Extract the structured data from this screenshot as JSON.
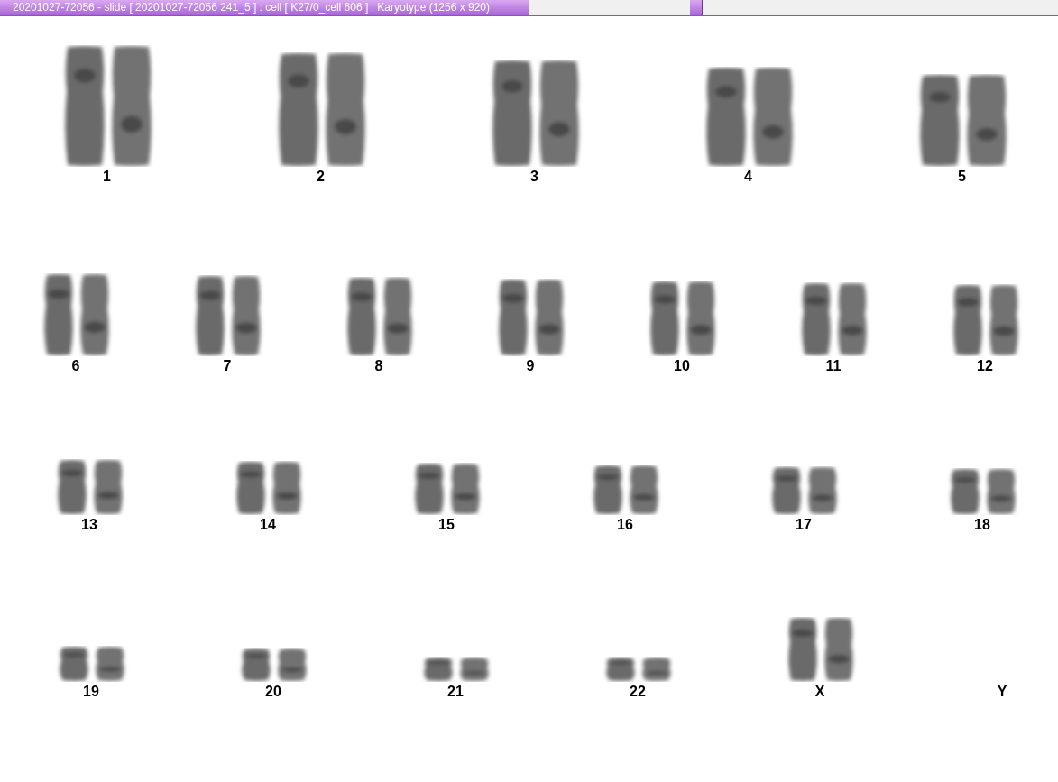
{
  "window": {
    "title": "20201027-72056 - slide [ 20201027-72056 241_5 ] : cell [ K27/0_cell 606 ] : Karyotype  (1256 x 920)"
  },
  "karyotype": {
    "rows": [
      {
        "groups": [
          {
            "label": "1",
            "kind": "pair"
          },
          {
            "label": "2",
            "kind": "pair"
          },
          {
            "label": "3",
            "kind": "pair"
          },
          {
            "label": "4",
            "kind": "pair"
          },
          {
            "label": "5",
            "kind": "pair"
          }
        ]
      },
      {
        "groups": [
          {
            "label": "6",
            "kind": "pair"
          },
          {
            "label": "7",
            "kind": "pair"
          },
          {
            "label": "8",
            "kind": "pair"
          },
          {
            "label": "9",
            "kind": "pair"
          },
          {
            "label": "10",
            "kind": "pair"
          },
          {
            "label": "11",
            "kind": "pair"
          },
          {
            "label": "12",
            "kind": "pair"
          }
        ]
      },
      {
        "groups": [
          {
            "label": "13",
            "kind": "pair"
          },
          {
            "label": "14",
            "kind": "pair"
          },
          {
            "label": "15",
            "kind": "pair"
          },
          {
            "label": "16",
            "kind": "pair"
          },
          {
            "label": "17",
            "kind": "pair"
          },
          {
            "label": "18",
            "kind": "pair"
          }
        ]
      },
      {
        "groups": [
          {
            "label": "19",
            "kind": "pair"
          },
          {
            "label": "20",
            "kind": "pair"
          },
          {
            "label": "21",
            "kind": "pair"
          },
          {
            "label": "22",
            "kind": "pair"
          },
          {
            "label": "X",
            "kind": "pair"
          },
          {
            "label": "Y",
            "kind": "empty"
          }
        ]
      }
    ]
  }
}
